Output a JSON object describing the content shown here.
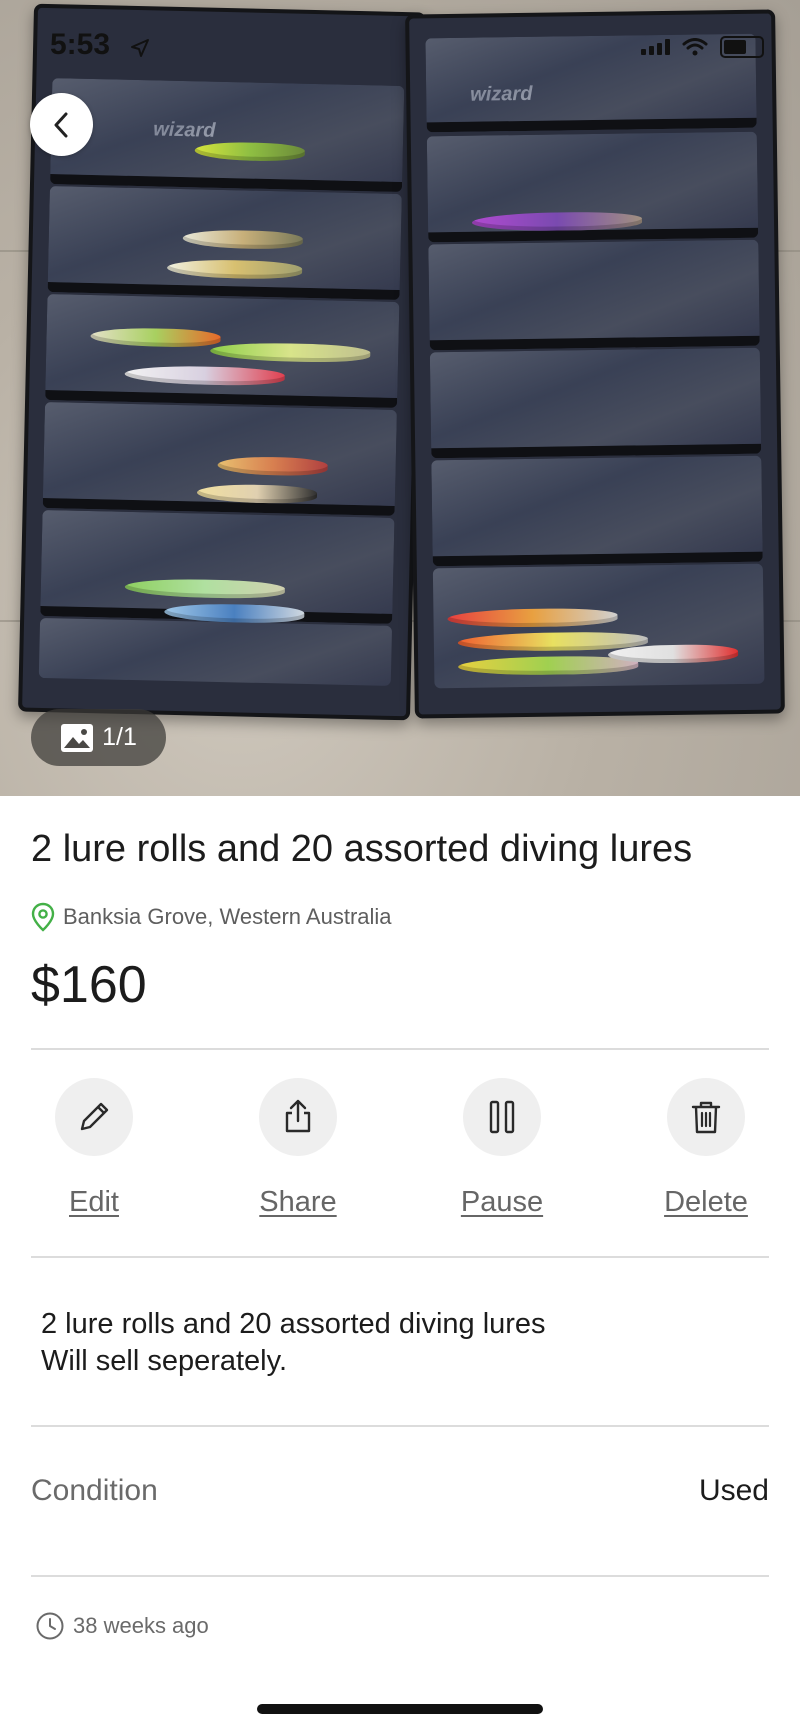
{
  "status_bar": {
    "time": "5:53"
  },
  "photo": {
    "logo_text": "wizard",
    "counter": "1/1"
  },
  "listing": {
    "title": "2 lure rolls and 20 assorted diving lures",
    "location": "Banksia Grove, Western Australia",
    "price": "$160"
  },
  "actions": [
    {
      "label": "Edit",
      "icon": "pencil-icon"
    },
    {
      "label": "Share",
      "icon": "share-icon"
    },
    {
      "label": "Pause",
      "icon": "pause-icon"
    },
    {
      "label": "Delete",
      "icon": "trash-icon"
    }
  ],
  "description": {
    "line1": "2 lure rolls and 20 assorted diving lures",
    "line2": "Will sell seperately."
  },
  "details": {
    "condition_label": "Condition",
    "condition_value": "Used"
  },
  "posted": "38 weeks ago",
  "colors": {
    "location_pin": "#43b047",
    "action_circle": "#efefef"
  }
}
